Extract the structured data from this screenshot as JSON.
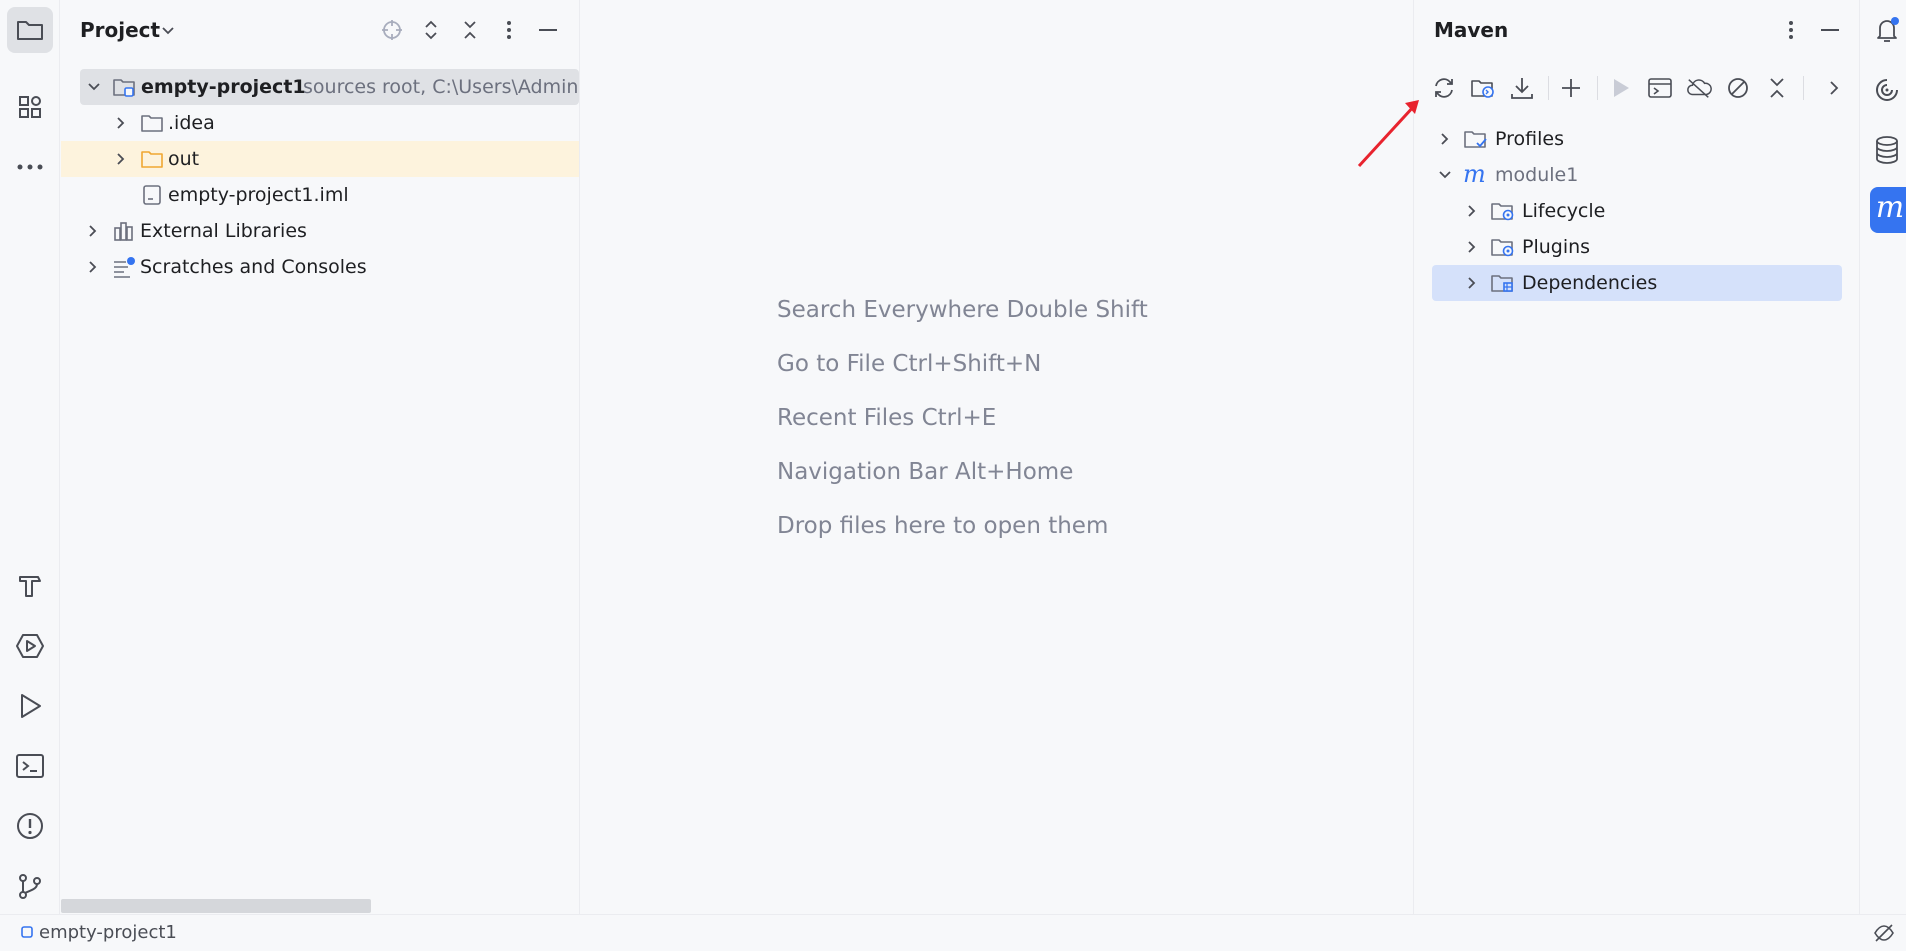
{
  "project_panel": {
    "title": "Project",
    "tree": [
      {
        "label": "empty-project1",
        "secondary": "sources root,  C:\\Users\\Admini"
      },
      {
        "label": ".idea"
      },
      {
        "label": "out"
      },
      {
        "label": "empty-project1.iml"
      },
      {
        "label": "External Libraries"
      },
      {
        "label": "Scratches and Consoles"
      }
    ]
  },
  "editor": {
    "hints": [
      "Search Everywhere Double Shift",
      "Go to File Ctrl+Shift+N",
      "Recent Files Ctrl+E",
      "Navigation Bar Alt+Home",
      "Drop files here to open them"
    ]
  },
  "maven_panel": {
    "title": "Maven",
    "tree": [
      {
        "label": "Profiles"
      },
      {
        "label": "module1"
      },
      {
        "label": "Lifecycle"
      },
      {
        "label": "Plugins"
      },
      {
        "label": "Dependencies"
      }
    ]
  },
  "status_bar": {
    "project": "empty-project1"
  },
  "colors": {
    "accent": "#3574f0",
    "selection": "#d5e1fa",
    "out_folder": "#f0a732",
    "annotation_arrow": "#e8232e"
  },
  "icons": {
    "left_strip": [
      "folder-icon",
      "structure-icon",
      "more-icon",
      "build-icon",
      "services-icon",
      "run-icon",
      "terminal-icon",
      "problems-icon",
      "git-icon"
    ],
    "right_strip": [
      "notifications-icon",
      "ai-assistant-icon",
      "database-icon",
      "maven-icon"
    ],
    "maven_toolbar": [
      "reload-icon",
      "generate-sources-icon",
      "download-icon",
      "add-icon",
      "run-icon",
      "execute-goal-icon",
      "offline-icon",
      "skip-tests-icon",
      "collapse-icon",
      "more-chevron-icon"
    ]
  }
}
